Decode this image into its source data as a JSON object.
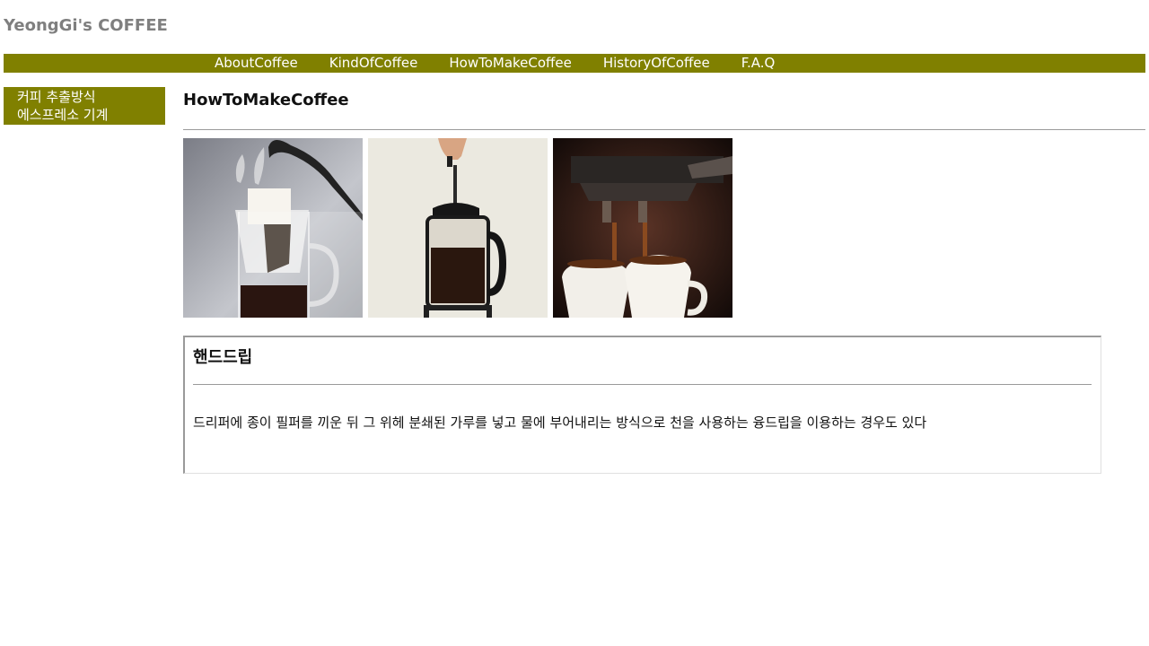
{
  "site": {
    "title": "YeongGi's COFFEE"
  },
  "nav": {
    "items": [
      {
        "label": "AboutCoffee"
      },
      {
        "label": "KindOfCoffee"
      },
      {
        "label": "HowToMakeCoffee"
      },
      {
        "label": "HistoryOfCoffee"
      },
      {
        "label": "F.A.Q"
      }
    ]
  },
  "sidebar": {
    "items": [
      {
        "label": "커피 추출방식"
      },
      {
        "label": "에스프레소 기계"
      }
    ]
  },
  "main": {
    "heading": "HowToMakeCoffee",
    "images": [
      {
        "icon": "hand-drip-photo"
      },
      {
        "icon": "french-press-photo"
      },
      {
        "icon": "espresso-photo"
      }
    ],
    "article": {
      "title": "핸드드립",
      "body": "드리퍼에 종이 필퍼를 끼운 뒤 그 위헤 분쇄된 가루를 넣고 물에 부어내리는 방식으로 천을 사용하는 융드립을 이용하는 경우도 있다"
    }
  },
  "colors": {
    "accent": "#808000",
    "title": "#7f7f7f",
    "divider": "#9a9a9a"
  }
}
